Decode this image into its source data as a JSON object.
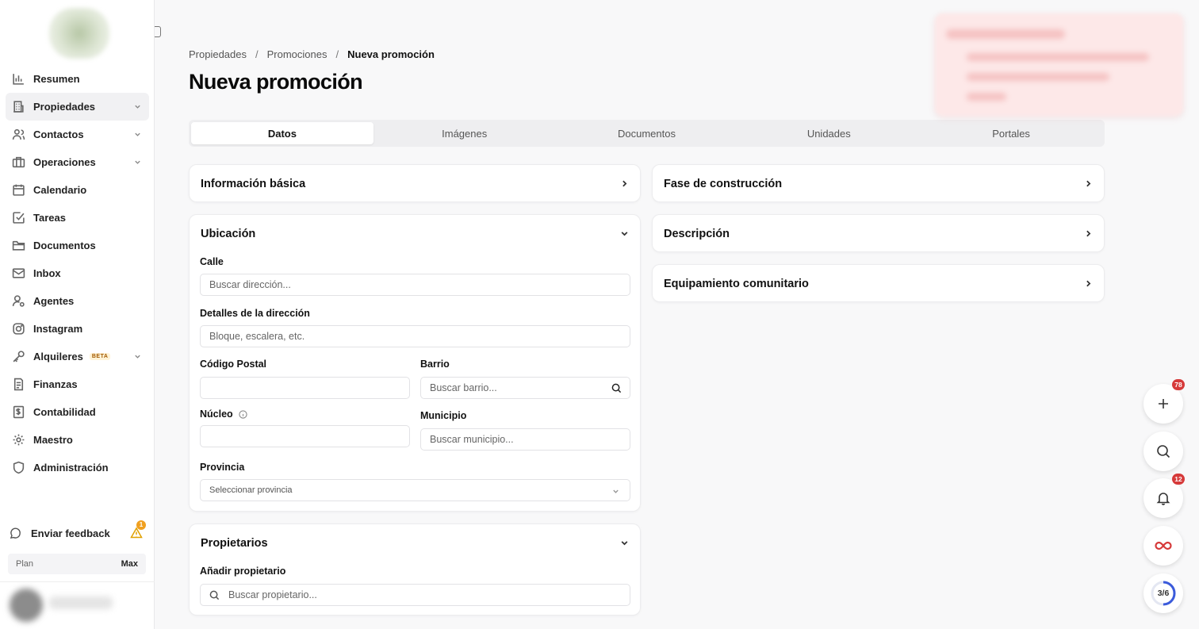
{
  "sidebar": {
    "items": [
      {
        "label": "Resumen",
        "icon": "bar-chart-icon",
        "chevron": false,
        "active": false
      },
      {
        "label": "Propiedades",
        "icon": "building-icon",
        "chevron": true,
        "active": true
      },
      {
        "label": "Contactos",
        "icon": "users-icon",
        "chevron": true,
        "active": false
      },
      {
        "label": "Operaciones",
        "icon": "briefcase-icon",
        "chevron": true,
        "active": false
      },
      {
        "label": "Calendario",
        "icon": "calendar-icon",
        "chevron": false,
        "active": false
      },
      {
        "label": "Tareas",
        "icon": "check-square-icon",
        "chevron": false,
        "active": false
      },
      {
        "label": "Documentos",
        "icon": "folder-icon",
        "chevron": false,
        "active": false
      },
      {
        "label": "Inbox",
        "icon": "inbox-icon",
        "chevron": false,
        "active": false
      },
      {
        "label": "Agentes",
        "icon": "user-gear-icon",
        "chevron": false,
        "active": false
      },
      {
        "label": "Instagram",
        "icon": "instagram-icon",
        "chevron": false,
        "active": false
      },
      {
        "label": "Alquileres",
        "icon": "key-icon",
        "chevron": true,
        "active": false,
        "badge": "BETA"
      },
      {
        "label": "Finanzas",
        "icon": "receipt-icon",
        "chevron": false,
        "active": false
      },
      {
        "label": "Contabilidad",
        "icon": "dollar-sheet-icon",
        "chevron": false,
        "active": false
      },
      {
        "label": "Maestro",
        "icon": "settings-icon",
        "chevron": false,
        "active": false
      },
      {
        "label": "Administración",
        "icon": "shield-icon",
        "chevron": false,
        "active": false
      }
    ],
    "feedback_label": "Enviar feedback",
    "feedback_alert_count": "1",
    "plan_label": "Plan",
    "plan_value": "Max"
  },
  "breadcrumb": {
    "items": [
      "Propiedades",
      "Promociones"
    ],
    "current": "Nueva promoción",
    "separator": "/"
  },
  "page_title": "Nueva promoción",
  "tabs": [
    "Datos",
    "Imágenes",
    "Documentos",
    "Unidades",
    "Portales"
  ],
  "active_tab": "Datos",
  "left_cards": {
    "basic": "Información básica",
    "location": {
      "title": "Ubicación",
      "street_label": "Calle",
      "street_placeholder": "Buscar dirección...",
      "details_label": "Detalles de la dirección",
      "details_placeholder": "Bloque, escalera, etc.",
      "postal_label": "Código Postal",
      "neighborhood_label": "Barrio",
      "neighborhood_placeholder": "Buscar barrio...",
      "nucleus_label": "Núcleo",
      "municipality_label": "Municipio",
      "municipality_placeholder": "Buscar municipio...",
      "province_label": "Provincia",
      "province_placeholder": "Seleccionar provincia"
    },
    "owners": {
      "title": "Propietarios",
      "add_label": "Añadir propietario",
      "search_placeholder": "Buscar propietario..."
    }
  },
  "right_cards": {
    "construction": "Fase de construcción",
    "description": "Descripción",
    "amenities": "Equipamiento comunitario"
  },
  "floating": {
    "add_badge": "78",
    "notifications_badge": "12",
    "progress": "3/6",
    "progress_fraction": 0.5
  },
  "colors": {
    "accent_badge": "#d63a3a",
    "warning": "#f0a020",
    "progress_ring": "#3b5bdb",
    "infinity": "#d63a3a"
  }
}
